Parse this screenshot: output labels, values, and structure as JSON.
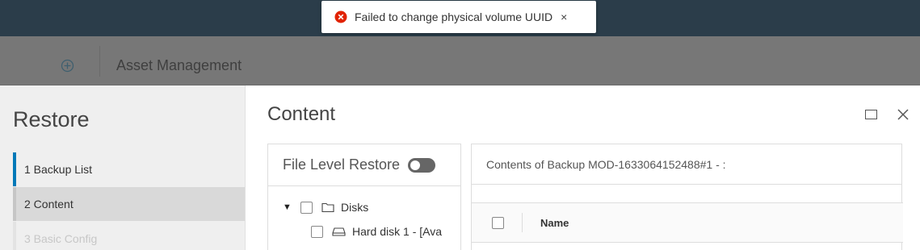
{
  "toast": {
    "message": "Failed to change physical volume UUID",
    "close_label": "×",
    "icon": "error-circle-icon"
  },
  "header": {
    "title": "Asset Management",
    "icon": "plus-circle-icon"
  },
  "wizard": {
    "title": "Restore",
    "steps": [
      {
        "label": "1  Backup List",
        "state": "completed"
      },
      {
        "label": "2  Content",
        "state": "active"
      },
      {
        "label": "3  Basic Config",
        "state": "disabled"
      }
    ]
  },
  "content": {
    "title": "Content",
    "file_level_restore_label": "File Level Restore",
    "file_level_restore_on": false,
    "tree": [
      {
        "label": "Disks",
        "expanded": true,
        "icon": "folder-icon",
        "caret": "▼"
      },
      {
        "label": "Hard disk 1 - [Ava",
        "icon": "disk-icon"
      }
    ],
    "contents_header": "Contents of Backup MOD-1633064152488#1 - :",
    "grid": {
      "columns": [
        "Name"
      ]
    }
  },
  "colors": {
    "topbar": "#2b3d4a",
    "accent": "#0079b8",
    "error": "#e12200"
  }
}
